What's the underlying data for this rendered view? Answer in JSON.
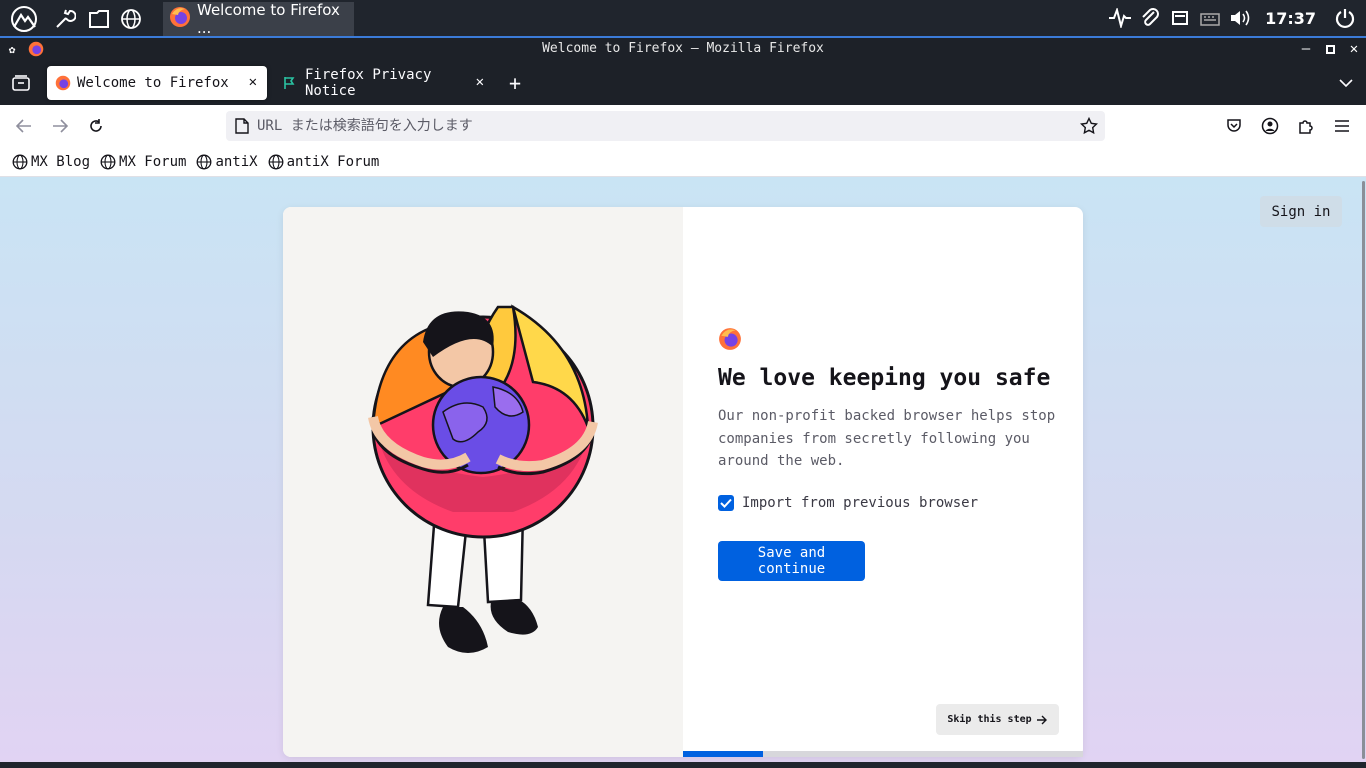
{
  "taskbar": {
    "task_title": "Welcome to Firefox ...",
    "clock": "17:37",
    "icons": [
      "mx-logo-icon",
      "wrench-icon",
      "folder-icon",
      "globe-icon",
      "activity-icon",
      "paperclip-icon",
      "drive-icon",
      "keyboard-icon",
      "volume-icon",
      "power-icon"
    ]
  },
  "window": {
    "title": "Welcome to Firefox — Mozilla Firefox"
  },
  "tabs": [
    {
      "label": "Welcome to Firefox",
      "active": true
    },
    {
      "label": "Firefox Privacy Notice",
      "active": false
    }
  ],
  "urlbar": {
    "placeholder": "URL または検索語句を入力します",
    "value": ""
  },
  "bookmarks": [
    {
      "label": "MX Blog"
    },
    {
      "label": "MX Forum"
    },
    {
      "label": "antiX"
    },
    {
      "label": "antiX Forum"
    }
  ],
  "page": {
    "signin_label": "Sign in",
    "heading": "We love keeping you safe",
    "subtitle": "Our non-profit backed browser helps stop companies from secretly following you around the web.",
    "checkbox_label": "Import from previous browser",
    "checkbox_checked": true,
    "primary_button": "Save and continue",
    "skip_button": "Skip this step",
    "progress_fraction": 0.2
  },
  "colors": {
    "accent": "#0061e0",
    "taskbar_bg": "#20252d",
    "taskbar_border": "#3b7bd8"
  }
}
